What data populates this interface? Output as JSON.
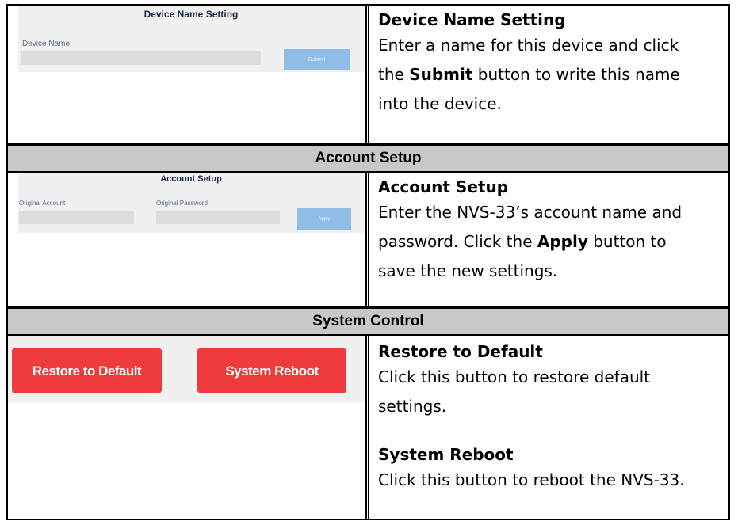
{
  "device_name": {
    "panel": {
      "title": "Device Name Setting",
      "field_label": "Device Name",
      "button": "Submit"
    },
    "desc": {
      "title": "Device Name Setting",
      "line1": "Enter a name for this device and click",
      "line2_pre": "the ",
      "line2_bold": "Submit",
      "line2_post": " button to write this name",
      "line3": "into the device."
    }
  },
  "account_setup": {
    "header": "Account Setup",
    "panel": {
      "title": "Account Setup",
      "label_account": "Original Account",
      "label_password": "Original Password",
      "button": "Apply"
    },
    "desc": {
      "title": "Account Setup",
      "line1": "Enter the NVS-33’s account name and",
      "line2_pre": "password. Click the ",
      "line2_bold": "Apply",
      "line2_post": " button to",
      "line3": "save the new settings."
    }
  },
  "system_control": {
    "header": "System Control",
    "buttons": {
      "restore": "Restore to Default",
      "reboot": "System Reboot"
    },
    "desc": {
      "restore_title": "Restore to Default",
      "restore_line1": "Click this button to restore default",
      "restore_line2": "settings.",
      "reboot_title": "System Reboot",
      "reboot_line1": "Click this button to reboot the NVS-33."
    }
  },
  "colors": {
    "header_bg": "#c8c8c8",
    "red_button": "#ef3b3b",
    "blue_button": "#8fbde8",
    "panel_bg": "#f0f0f0"
  }
}
